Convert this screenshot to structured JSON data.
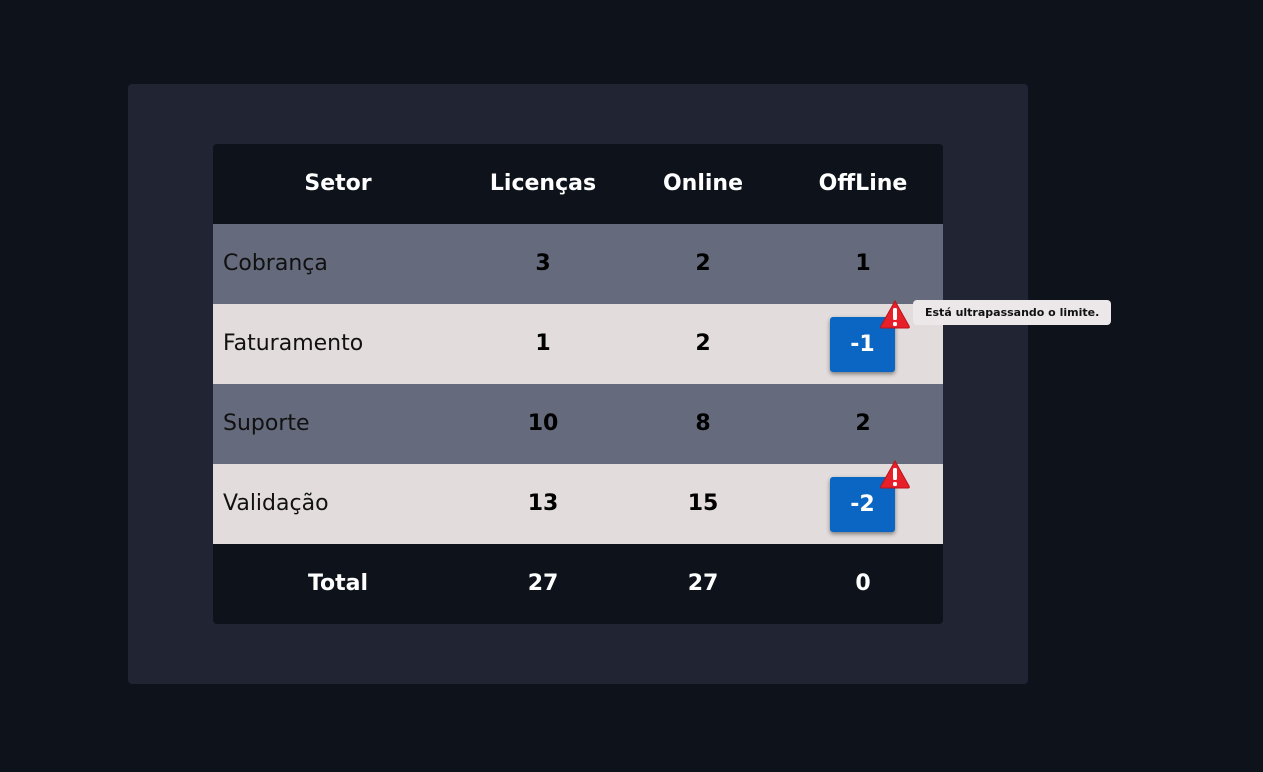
{
  "table": {
    "headers": [
      "Setor",
      "Licenças",
      "Online",
      "OffLine"
    ],
    "rows": [
      {
        "setor": "Cobrança",
        "licencas": "3",
        "online": "2",
        "offline": "1",
        "warning": false
      },
      {
        "setor": "Faturamento",
        "licencas": "1",
        "online": "2",
        "offline": "-1",
        "warning": true
      },
      {
        "setor": "Suporte",
        "licencas": "10",
        "online": "8",
        "offline": "2",
        "warning": false
      },
      {
        "setor": "Validação",
        "licencas": "13",
        "online": "15",
        "offline": "-2",
        "warning": true
      }
    ],
    "total": {
      "label": "Total",
      "licencas": "27",
      "online": "27",
      "offline": "0"
    }
  },
  "tooltip": {
    "text": "Está ultrapassando o limite."
  },
  "icons": {
    "warning": "warning-triangle-icon"
  },
  "colors": {
    "page_bg": "#0e121b",
    "panel_bg": "#212533",
    "row_odd": "#656a7c",
    "row_even": "#e2dcdc",
    "badge": "#0a66c2",
    "warning": "#e8202a"
  }
}
